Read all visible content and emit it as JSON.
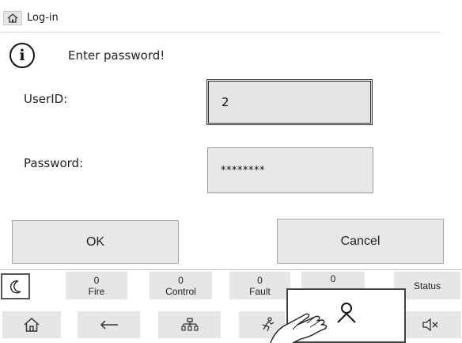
{
  "header": {
    "home_icon": "home-icon",
    "breadcrumb": "Log-in"
  },
  "message": {
    "icon": "info-icon",
    "info_glyph": "i",
    "text": "Enter password!"
  },
  "form": {
    "userid_label": "UserID:",
    "userid_value": "2",
    "password_label": "Password:",
    "password_value": "********"
  },
  "buttons": {
    "ok": "OK",
    "cancel": "Cancel"
  },
  "status_bar": {
    "night_icon": "moon-icon",
    "counters": [
      {
        "count": "0",
        "label": "Fire"
      },
      {
        "count": "0",
        "label": "Control"
      },
      {
        "count": "0",
        "label": "Fault"
      },
      {
        "count": "0",
        "label": ""
      }
    ],
    "status_label": "Status"
  },
  "nav": {
    "home": "home-icon",
    "back": "arrow-left-icon",
    "tree": "network-tree-icon",
    "evacuation": "evacuation-icon",
    "mute": "speaker-mute-icon"
  },
  "popup": {
    "icon": "user-icon"
  },
  "overlay": {
    "icon": "hand-pointer-icon"
  }
}
